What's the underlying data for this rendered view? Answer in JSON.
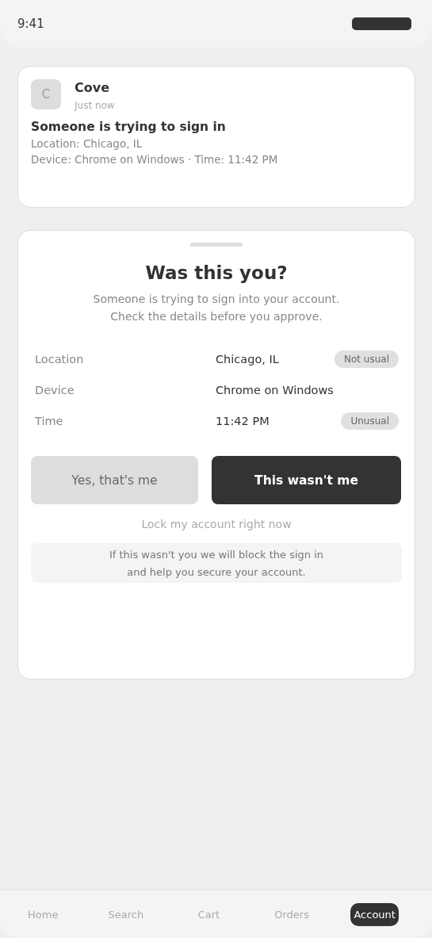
{
  "status_bar": {
    "time": "9:41"
  },
  "notification": {
    "avatar_letter": "C",
    "app": "Cove",
    "when": "Just now",
    "title": "Someone is trying to sign in",
    "lines": [
      "Location: Chicago, IL",
      "Device: Chrome on Windows · Time: 11:42 PM"
    ]
  },
  "sheet": {
    "title": "Was this you?",
    "subtitle": [
      "Someone is trying to sign into your account.",
      "Check the details before you approve."
    ],
    "details": [
      {
        "label": "Location",
        "value": "Chicago, IL",
        "badge": "Not usual"
      },
      {
        "label": "Device",
        "value": "Chrome on Windows"
      },
      {
        "label": "Time",
        "value": "11:42 PM",
        "badge": "Unusual"
      }
    ],
    "buttons": [
      {
        "label": "Yes, that's me",
        "kind": "secondary"
      },
      {
        "label": "This wasn't me",
        "kind": "primary"
      }
    ],
    "link": "Lock my account right now",
    "note": [
      "If this wasn't you we will block the sign in",
      "and help you secure your account."
    ]
  },
  "tabs": [
    {
      "label": "Home",
      "selected": false
    },
    {
      "label": "Search",
      "selected": false
    },
    {
      "label": "Cart",
      "selected": false
    },
    {
      "label": "Orders",
      "selected": false
    },
    {
      "label": "Account",
      "selected": true
    }
  ]
}
